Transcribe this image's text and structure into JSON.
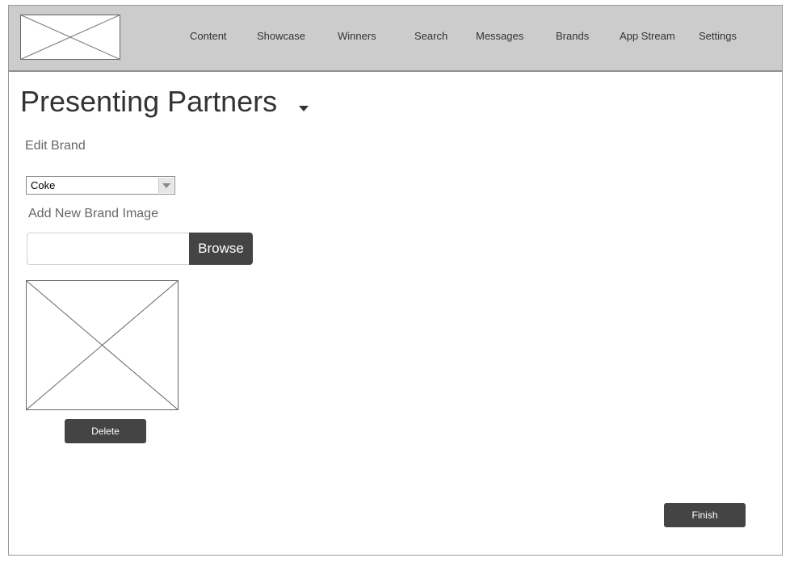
{
  "nav": {
    "items": [
      {
        "label": "Content"
      },
      {
        "label": "Showcase"
      },
      {
        "label": "Winners"
      },
      {
        "label": "Search"
      },
      {
        "label": "Messages"
      },
      {
        "label": "Brands"
      },
      {
        "label": "App Stream"
      },
      {
        "label": "Settings"
      }
    ]
  },
  "page": {
    "title": "Presenting Partners"
  },
  "edit_brand": {
    "label": "Edit Brand",
    "select": {
      "selected": "Coke"
    }
  },
  "add_image": {
    "label": "Add New Brand Image",
    "input_value": "",
    "browse_label": "Browse"
  },
  "brand_image": {
    "delete_label": "Delete"
  },
  "footer": {
    "finish_label": "Finish"
  },
  "icons": {
    "logo": "image-placeholder-icon",
    "title_dropdown": "caret-down-icon",
    "select_arrow": "chevron-down-icon",
    "brand_image": "image-placeholder-icon"
  },
  "colors": {
    "header_bg": "#cccccc",
    "button_bg": "#444444",
    "text": "#333333"
  }
}
